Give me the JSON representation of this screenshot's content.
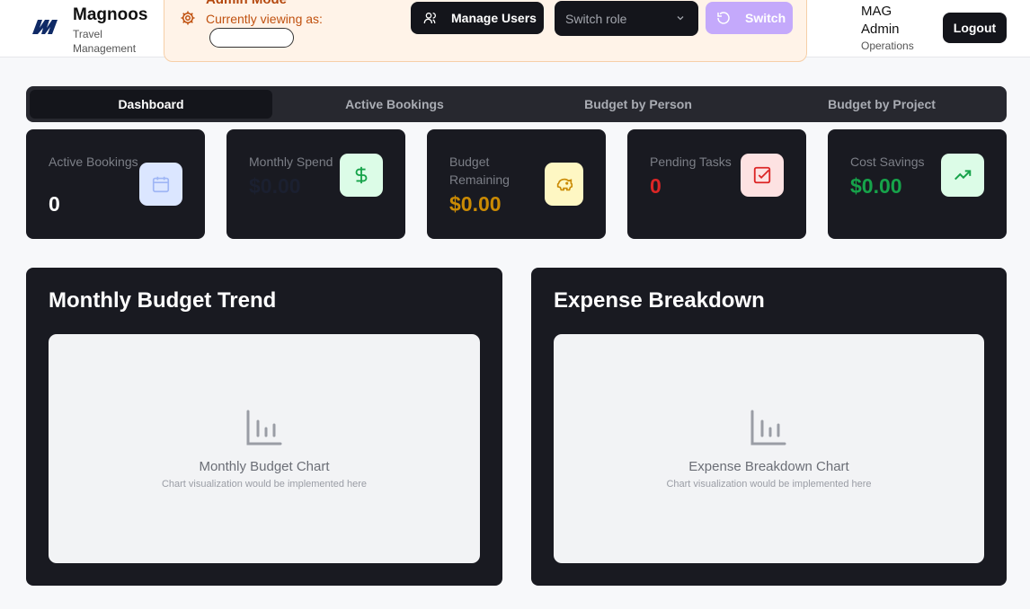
{
  "brand": {
    "name": "Magnoos",
    "subtitle": "Travel Management"
  },
  "admin_banner": {
    "mode": "Admin Mode",
    "viewing_label": "Currently viewing as:"
  },
  "actions": {
    "manage_users": "Manage Users",
    "role_placeholder": "Switch role",
    "switch": "Switch"
  },
  "user": {
    "initials": "MAG",
    "role": "Admin",
    "department": "Operations",
    "logout": "Logout"
  },
  "tabs": [
    {
      "label": "Dashboard",
      "active": true
    },
    {
      "label": "Active Bookings",
      "active": false
    },
    {
      "label": "Budget by Person",
      "active": false
    },
    {
      "label": "Budget by Project",
      "active": false
    }
  ],
  "stats": [
    {
      "label": "Active Bookings",
      "value": "0",
      "icon": "calendar-icon",
      "value_color": "#ffffff",
      "icon_bg": "#dbe6ff",
      "icon_color": "#9fb6f5"
    },
    {
      "label": "Monthly Spend",
      "value": "$0.00",
      "icon": "dollar-icon",
      "value_color": "#1b2030",
      "icon_bg": "#dcfce7",
      "icon_color": "#16a34a"
    },
    {
      "label": "Budget Remaining",
      "value": "$0.00",
      "icon": "piggy-bank-icon",
      "value_color": "#ca8a04",
      "icon_bg": "#fef7c3",
      "icon_color": "#ca8a04"
    },
    {
      "label": "Pending Tasks",
      "value": "0",
      "icon": "check-square-icon",
      "value_color": "#dc2626",
      "icon_bg": "#fde2e2",
      "icon_color": "#dc2626"
    },
    {
      "label": "Cost Savings",
      "value": "$0.00",
      "icon": "trending-up-icon",
      "value_color": "#16a34a",
      "icon_bg": "#dcfce7",
      "icon_color": "#16a34a"
    }
  ],
  "panels": [
    {
      "title": "Monthly Budget Trend",
      "placeholder_title": "Monthly Budget Chart",
      "placeholder_sub": "Chart visualization would be implemented here",
      "icon": "bar-chart-icon"
    },
    {
      "title": "Expense Breakdown",
      "placeholder_title": "Expense Breakdown Chart",
      "placeholder_sub": "Chart visualization would be implemented here",
      "icon": "bar-chart-icon"
    }
  ]
}
